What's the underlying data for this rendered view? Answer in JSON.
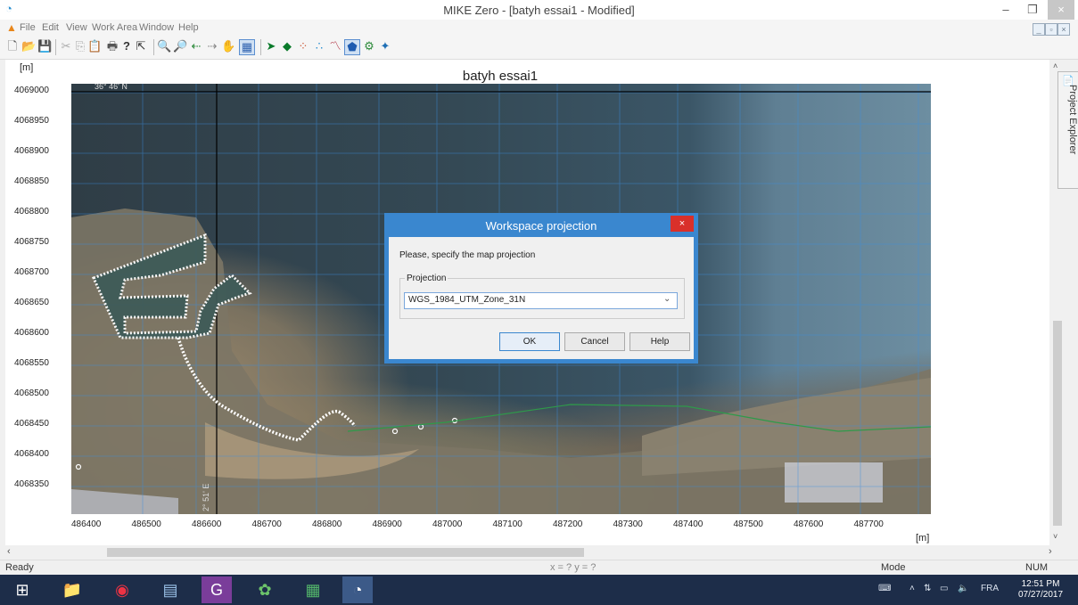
{
  "window": {
    "title": "MIKE Zero - [batyh essai1 - Modified]",
    "minimize": "–",
    "maximize": "❐",
    "close": "×"
  },
  "menu": {
    "items": [
      "File",
      "Edit",
      "View",
      "Work Area",
      "Window",
      "Help"
    ]
  },
  "plot": {
    "title": "batyh essai1",
    "y_unit": "[m]",
    "x_unit": "[m]",
    "y_ticks": [
      "4069000",
      "4068950",
      "4068900",
      "4068850",
      "4068800",
      "4068750",
      "4068700",
      "4068650",
      "4068600",
      "4068550",
      "4068500",
      "4068450",
      "4068400",
      "4068350"
    ],
    "x_ticks": [
      "486400",
      "486500",
      "486600",
      "486700",
      "486800",
      "486900",
      "487000",
      "487100",
      "487200",
      "487300",
      "487400",
      "487500",
      "487600",
      "487700"
    ],
    "lat_label": "36° 46' N",
    "lon_label": "2° 51' E"
  },
  "side_panel": {
    "label": "Project Explorer"
  },
  "status": {
    "ready": "Ready",
    "coords": "x = ? y = ?",
    "mode": "Mode",
    "num": "NUM"
  },
  "dialog": {
    "title": "Workspace projection",
    "close": "×",
    "prompt": "Please, specify the map projection",
    "group_label": "Projection",
    "projection_value": "WGS_1984_UTM_Zone_31N",
    "ok": "OK",
    "cancel": "Cancel",
    "help": "Help"
  },
  "taskbar": {
    "lang": "FRA",
    "time": "12:51 PM",
    "date": "07/27/2017"
  }
}
